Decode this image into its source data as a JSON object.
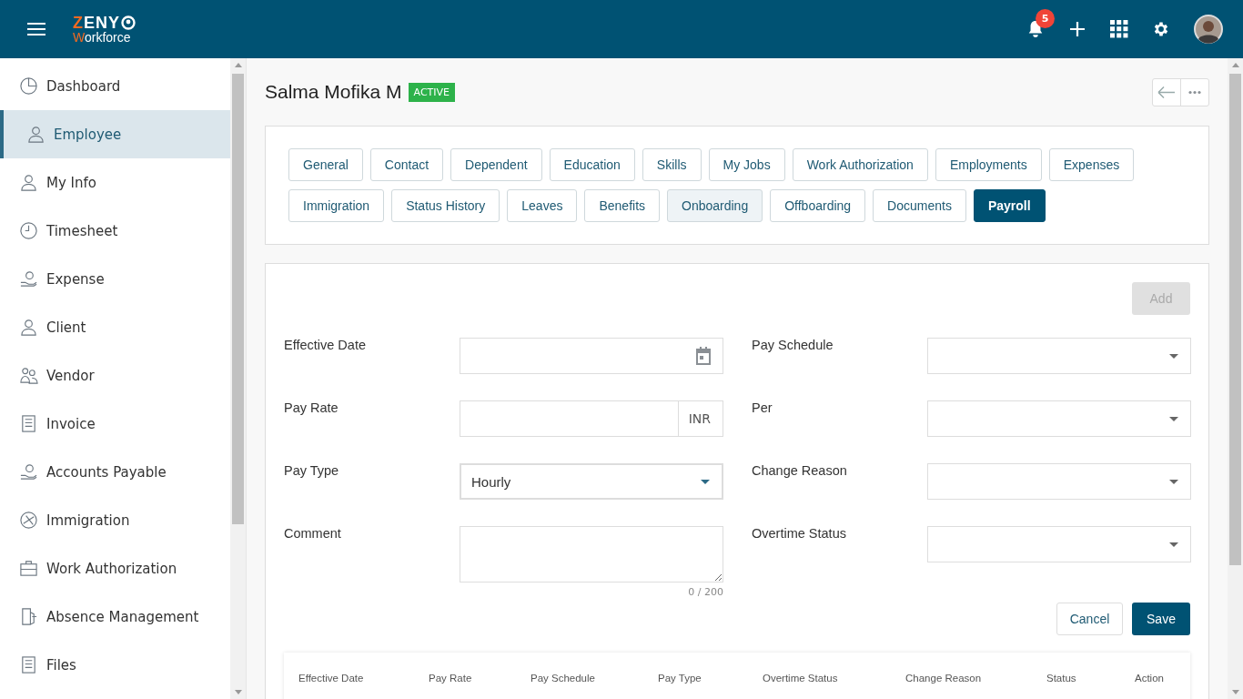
{
  "header": {
    "logo": {
      "brand": "ZENY",
      "sub": "Workforce"
    },
    "notifications": "5"
  },
  "sidebar": {
    "items": [
      {
        "label": "Dashboard",
        "selected": false
      },
      {
        "label": "Employee",
        "selected": true
      },
      {
        "label": "My Info",
        "selected": false
      },
      {
        "label": "Timesheet",
        "selected": false
      },
      {
        "label": "Expense",
        "selected": false
      },
      {
        "label": "Client",
        "selected": false
      },
      {
        "label": "Vendor",
        "selected": false
      },
      {
        "label": "Invoice",
        "selected": false
      },
      {
        "label": "Accounts Payable",
        "selected": false
      },
      {
        "label": "Immigration",
        "selected": false
      },
      {
        "label": "Work Authorization",
        "selected": false
      },
      {
        "label": "Absence Management",
        "selected": false
      },
      {
        "label": "Files",
        "selected": false
      }
    ]
  },
  "profile": {
    "name": "Salma Mofika M",
    "status": "ACTIVE"
  },
  "tabs": [
    {
      "label": "General",
      "selected": false,
      "hovered": false
    },
    {
      "label": "Contact",
      "selected": false,
      "hovered": false
    },
    {
      "label": "Dependent",
      "selected": false,
      "hovered": false
    },
    {
      "label": "Education",
      "selected": false,
      "hovered": false
    },
    {
      "label": "Skills",
      "selected": false,
      "hovered": false
    },
    {
      "label": "My Jobs",
      "selected": false,
      "hovered": false
    },
    {
      "label": "Work Authorization",
      "selected": false,
      "hovered": false
    },
    {
      "label": "Employments",
      "selected": false,
      "hovered": false
    },
    {
      "label": "Expenses",
      "selected": false,
      "hovered": false
    },
    {
      "label": "Immigration",
      "selected": false,
      "hovered": false
    },
    {
      "label": "Status History",
      "selected": false,
      "hovered": false
    },
    {
      "label": "Leaves",
      "selected": false,
      "hovered": false
    },
    {
      "label": "Benefits",
      "selected": false,
      "hovered": false
    },
    {
      "label": "Onboarding",
      "selected": false,
      "hovered": true
    },
    {
      "label": "Offboarding",
      "selected": false,
      "hovered": false
    },
    {
      "label": "Documents",
      "selected": false,
      "hovered": false
    },
    {
      "label": "Payroll",
      "selected": true,
      "hovered": false
    }
  ],
  "form": {
    "add_button": {
      "label": "Add",
      "disabled": true
    },
    "left_fields": [
      {
        "label": "Effective Date",
        "kind": "date"
      },
      {
        "label": "Pay Rate",
        "kind": "currency",
        "suffix": "INR"
      },
      {
        "label": "Pay Type",
        "kind": "select",
        "value": "Hourly",
        "focused": true
      },
      {
        "label": "Comment",
        "kind": "textarea",
        "counter": "0 / 200"
      }
    ],
    "right_fields": [
      {
        "label": "Pay Schedule",
        "kind": "select",
        "focused": false
      },
      {
        "label": "Per",
        "kind": "select",
        "focused": false
      },
      {
        "label": "Change Reason",
        "kind": "select",
        "focused": false
      },
      {
        "label": "Overtime Status",
        "kind": "select",
        "focused": false
      }
    ],
    "buttons": {
      "cancel": "Cancel",
      "save": "Save"
    }
  },
  "table": {
    "columns": [
      "Effective Date",
      "Pay Rate",
      "Pay Schedule",
      "Pay Type",
      "Overtime Status",
      "Change Reason",
      "Status",
      "Action"
    ]
  }
}
